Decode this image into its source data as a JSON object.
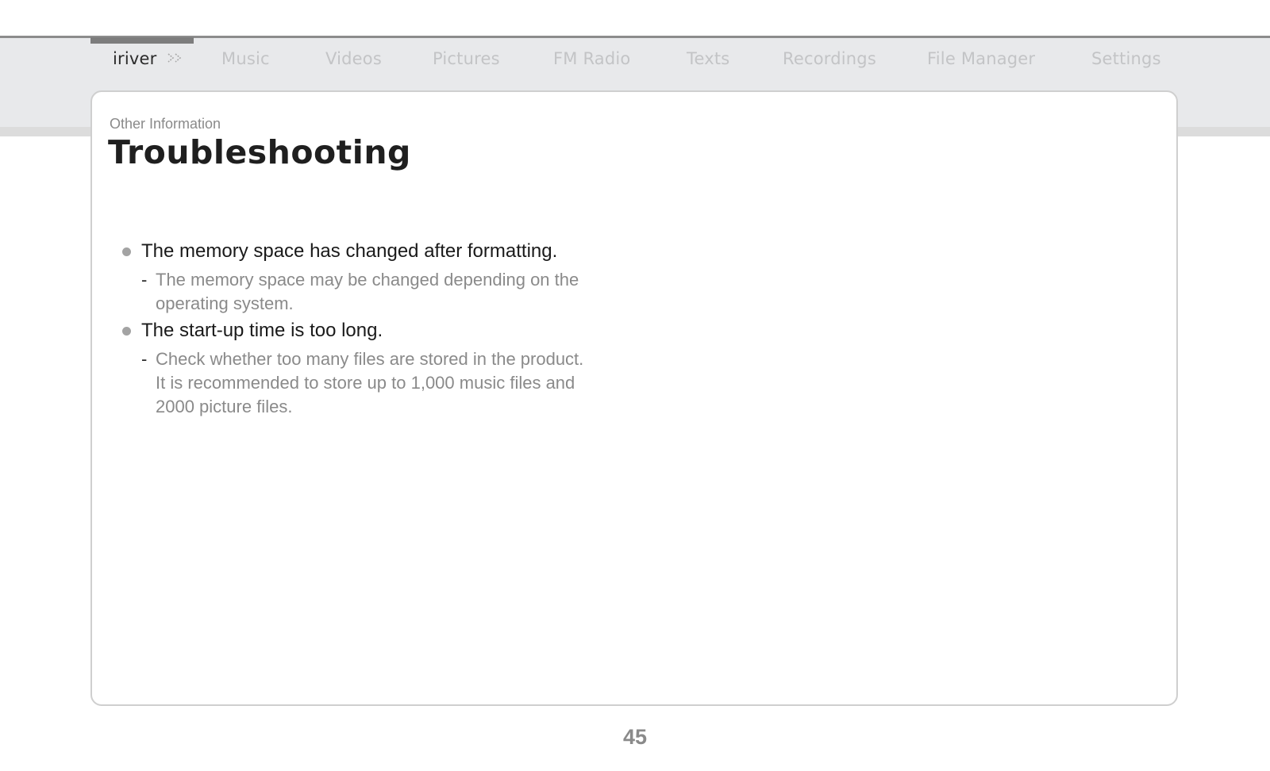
{
  "nav": {
    "brand": "iriver",
    "brand_icon": "double-chevron-right-icon",
    "items": [
      {
        "label": "Music"
      },
      {
        "label": "Videos"
      },
      {
        "label": "Pictures"
      },
      {
        "label": "FM Radio"
      },
      {
        "label": "Texts"
      },
      {
        "label": "Recordings"
      },
      {
        "label": "File Manager"
      },
      {
        "label": "Settings"
      }
    ]
  },
  "content": {
    "section_label": "Other Information",
    "title": "Troubleshooting",
    "items": [
      {
        "question": "The memory space has changed after formatting.",
        "answer_lines": [
          "The memory space may be changed depending on the",
          "operating system."
        ]
      },
      {
        "question": "The start-up time is too long.",
        "answer_lines": [
          "Check whether too many files are stored in the product.",
          "It is recommended to store up to 1,000 music files and",
          "2000 picture files."
        ]
      }
    ]
  },
  "footer": {
    "page_number": "45"
  },
  "colors": {
    "nav_band": "#e8e9eb",
    "nav_inactive_text": "#c3c4c6",
    "card_border": "#cfcfcf",
    "answer_text": "#8a8a8a"
  }
}
